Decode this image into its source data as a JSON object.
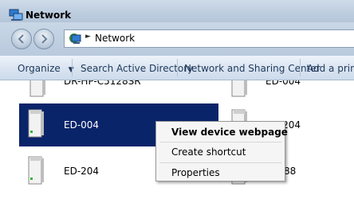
{
  "window": {
    "title": "Network"
  },
  "address": {
    "path": "Network"
  },
  "toolbar": {
    "items": [
      "Organize",
      "Search Active Directory",
      "Network and Sharing Center",
      "Add a printe"
    ]
  },
  "devices": [
    {
      "name": "DR-HP-C5128SR",
      "selected": false
    },
    {
      "name": "ED-004",
      "selected": false
    },
    {
      "name": "ED-004",
      "selected": true
    },
    {
      "name": "ED-204",
      "selected": false
    },
    {
      "name": "ED-204",
      "selected": false
    },
    {
      "name": "88",
      "selected": false
    }
  ],
  "context_menu": {
    "items": [
      "View device webpage",
      "Create shortcut",
      "Properties"
    ],
    "default_item": "View device webpage"
  },
  "icons": {
    "title": "network-icon",
    "back": "back-arrow-icon",
    "forward": "forward-arrow-icon",
    "device": "network-device-icon",
    "dropdown": "chevron-down-icon"
  },
  "colors": {
    "selection": "#0a246a",
    "toolbar_text": "#1e395b"
  }
}
